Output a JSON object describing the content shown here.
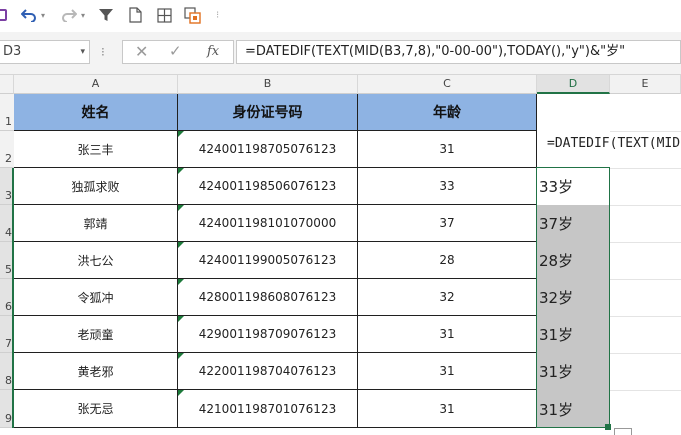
{
  "toolbar": {
    "icons": [
      "save-icon",
      "undo-icon",
      "redo-icon",
      "filter-icon",
      "document-icon",
      "table-grid-icon",
      "copy-format-icon"
    ],
    "dropdown_glyph": "▾",
    "separator": "⁝"
  },
  "formula_bar": {
    "name_box": "D3",
    "cancel_glyph": "✕",
    "confirm_glyph": "✓",
    "fx_label": "fx",
    "formula": "=DATEDIF(TEXT(MID(B3,7,8),\"0-00-00\"),TODAY(),\"y\")&\"岁\""
  },
  "columns": [
    "A",
    "B",
    "C",
    "D",
    "E"
  ],
  "rows": [
    "1",
    "2",
    "3",
    "4",
    "5",
    "6",
    "7",
    "8",
    "9"
  ],
  "table": {
    "headers": [
      "姓名",
      "身份证号码",
      "年龄"
    ],
    "records": [
      {
        "name": "张三丰",
        "id": "424001198705076123",
        "age": "31"
      },
      {
        "name": "独孤求败",
        "id": "424001198506076123",
        "age": "33"
      },
      {
        "name": "郭靖",
        "id": "424001198101070000",
        "age": "37"
      },
      {
        "name": "洪七公",
        "id": "424001199005076123",
        "age": "28"
      },
      {
        "name": "令狐冲",
        "id": "428001198608076123",
        "age": "32"
      },
      {
        "name": "老顽童",
        "id": "429001198709076123",
        "age": "31"
      },
      {
        "name": "黄老邪",
        "id": "422001198704076123",
        "age": "31"
      },
      {
        "name": "张无忌",
        "id": "421001198701076123",
        "age": "31"
      }
    ]
  },
  "column_d": {
    "formula_preview": "=DATEDIF(TEXT(MID",
    "results": [
      "33岁",
      "37岁",
      "28岁",
      "32岁",
      "31岁",
      "31岁",
      "31岁"
    ]
  },
  "colors": {
    "header_fill": "#8eb3e3",
    "selection": "#217346",
    "selected_fill": "#c6c6c6"
  }
}
